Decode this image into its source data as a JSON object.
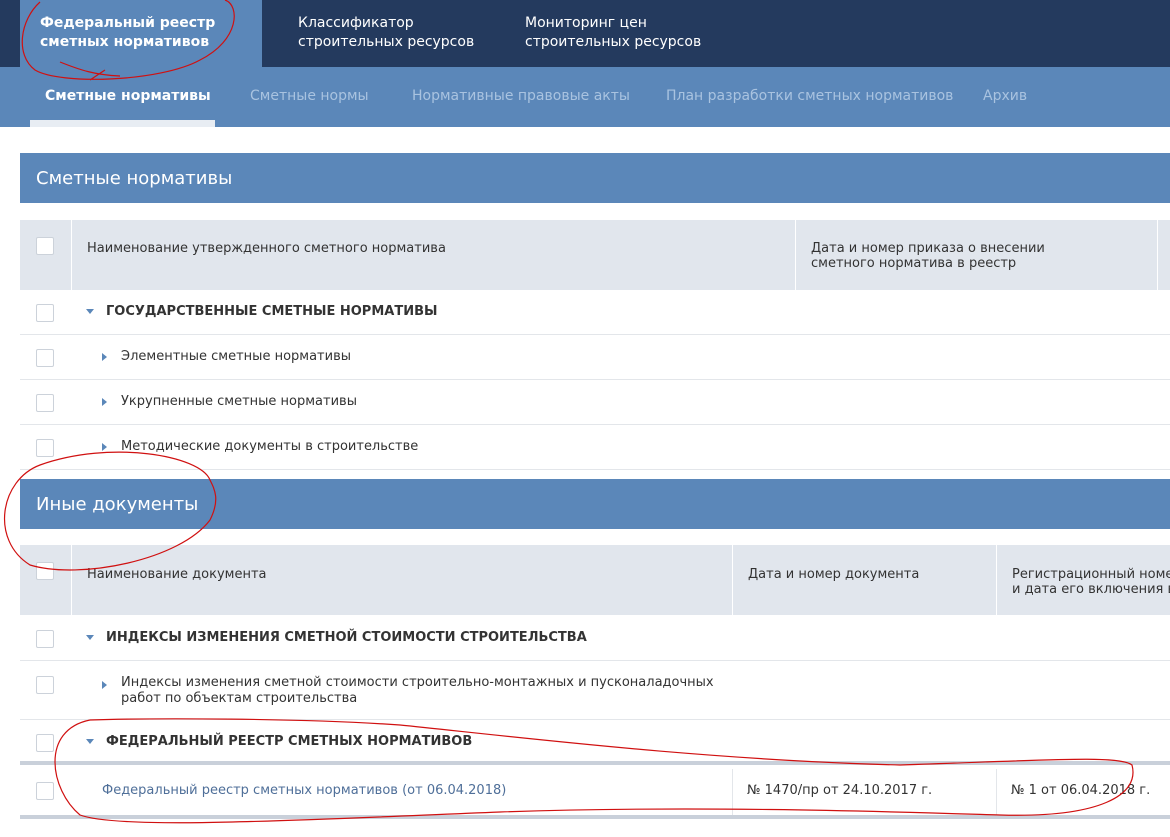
{
  "top_nav": [
    {
      "label": "Федеральный реестр\nсметных нормативов",
      "active": true
    },
    {
      "label": "Классификатор\nстроительных ресурсов"
    },
    {
      "label": "Мониторинг цен\nстроительных ресурсов"
    }
  ],
  "sub_nav": [
    "Сметные нормативы",
    "Сметные нормы",
    "Нормативные правовые акты",
    "План разработки сметных нормативов",
    "Архив"
  ],
  "section1": {
    "title": "Сметные нормативы",
    "headers": [
      "Наименование утвержденного сметного норматива",
      "Дата и номер приказа о внесении сметного норматива в реестр"
    ],
    "group": "Государственные сметные нормативы",
    "items": [
      "Элементные сметные нормативы",
      "Укрупненные сметные нормативы",
      "Методические документы в строительстве"
    ]
  },
  "section2": {
    "title": "Иные документы",
    "headers": [
      "Наименование документа",
      "Дата и номер документа",
      "Регистрационный номер\nи дата его включения в р"
    ],
    "group1": "Индексы изменения сметной стоимости строительства",
    "item1": "Индексы изменения сметной стоимости строительно-монтажных и пусконаладочных работ по объектам строительства",
    "group2": "Федеральный реестр сметных нормативов",
    "doc": {
      "name": "Федеральный реестр сметных нормативов (от 06.04.2018)",
      "date_number": "№ 1470/пр от 24.10.2017 г.",
      "reg": "№ 1 от 06.04.2018 г."
    }
  },
  "colors": {
    "dark_nav": "#243a5e",
    "accent": "#5b87b9",
    "header_bg": "#e1e6ed",
    "annotation": "#d01010"
  }
}
